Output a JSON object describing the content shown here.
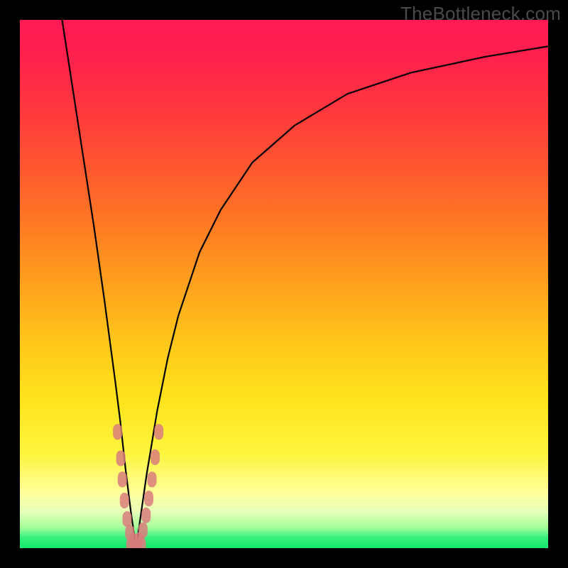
{
  "watermark": "TheBottleneck.com",
  "chart_data": {
    "type": "line",
    "title": "",
    "xlabel": "",
    "ylabel": "",
    "xlim": [
      0,
      100
    ],
    "ylim": [
      0,
      100
    ],
    "optimum_x": 22,
    "series": [
      {
        "name": "bottleneck-curve",
        "x": [
          8,
          10,
          12,
          14,
          16,
          18,
          19,
          20,
          21,
          22,
          23,
          24,
          25,
          26,
          28,
          30,
          34,
          38,
          44,
          52,
          62,
          74,
          88,
          100
        ],
        "y": [
          100,
          87,
          74,
          61,
          47,
          32,
          24,
          15,
          7,
          0,
          7,
          14,
          20,
          26,
          36,
          44,
          56,
          64,
          73,
          80,
          86,
          90,
          93,
          95
        ],
        "color": "#000000"
      }
    ],
    "markers": [
      {
        "name": "sample-points-left",
        "shape": "rounded",
        "color": "#d97d7d",
        "points": [
          {
            "x": 18.5,
            "y": 22
          },
          {
            "x": 19.1,
            "y": 17
          },
          {
            "x": 19.4,
            "y": 13
          },
          {
            "x": 19.8,
            "y": 9
          },
          {
            "x": 20.3,
            "y": 5.5
          },
          {
            "x": 20.8,
            "y": 2.9
          },
          {
            "x": 21.5,
            "y": 1.4
          }
        ]
      },
      {
        "name": "sample-points-right",
        "shape": "rounded",
        "color": "#d97d7d",
        "points": [
          {
            "x": 22.6,
            "y": 1.5
          },
          {
            "x": 23.3,
            "y": 3.4
          },
          {
            "x": 23.9,
            "y": 6.2
          },
          {
            "x": 24.4,
            "y": 9.4
          },
          {
            "x": 25.0,
            "y": 13.0
          },
          {
            "x": 25.6,
            "y": 17.2
          },
          {
            "x": 26.3,
            "y": 22.0
          }
        ]
      },
      {
        "name": "sample-points-bottom",
        "shape": "rounded",
        "color": "#d97d7d",
        "points": [
          {
            "x": 21.0,
            "y": 0.5
          },
          {
            "x": 22.0,
            "y": 0.2
          },
          {
            "x": 23.0,
            "y": 0.6
          }
        ]
      }
    ],
    "gradient_stops": [
      {
        "pos": 0,
        "color": "#ff1a54"
      },
      {
        "pos": 18,
        "color": "#ff3a3c"
      },
      {
        "pos": 48,
        "color": "#ff9a1e"
      },
      {
        "pos": 72,
        "color": "#ffe41c"
      },
      {
        "pos": 90,
        "color": "#fdffa0"
      },
      {
        "pos": 100,
        "color": "#14e86c"
      }
    ]
  }
}
